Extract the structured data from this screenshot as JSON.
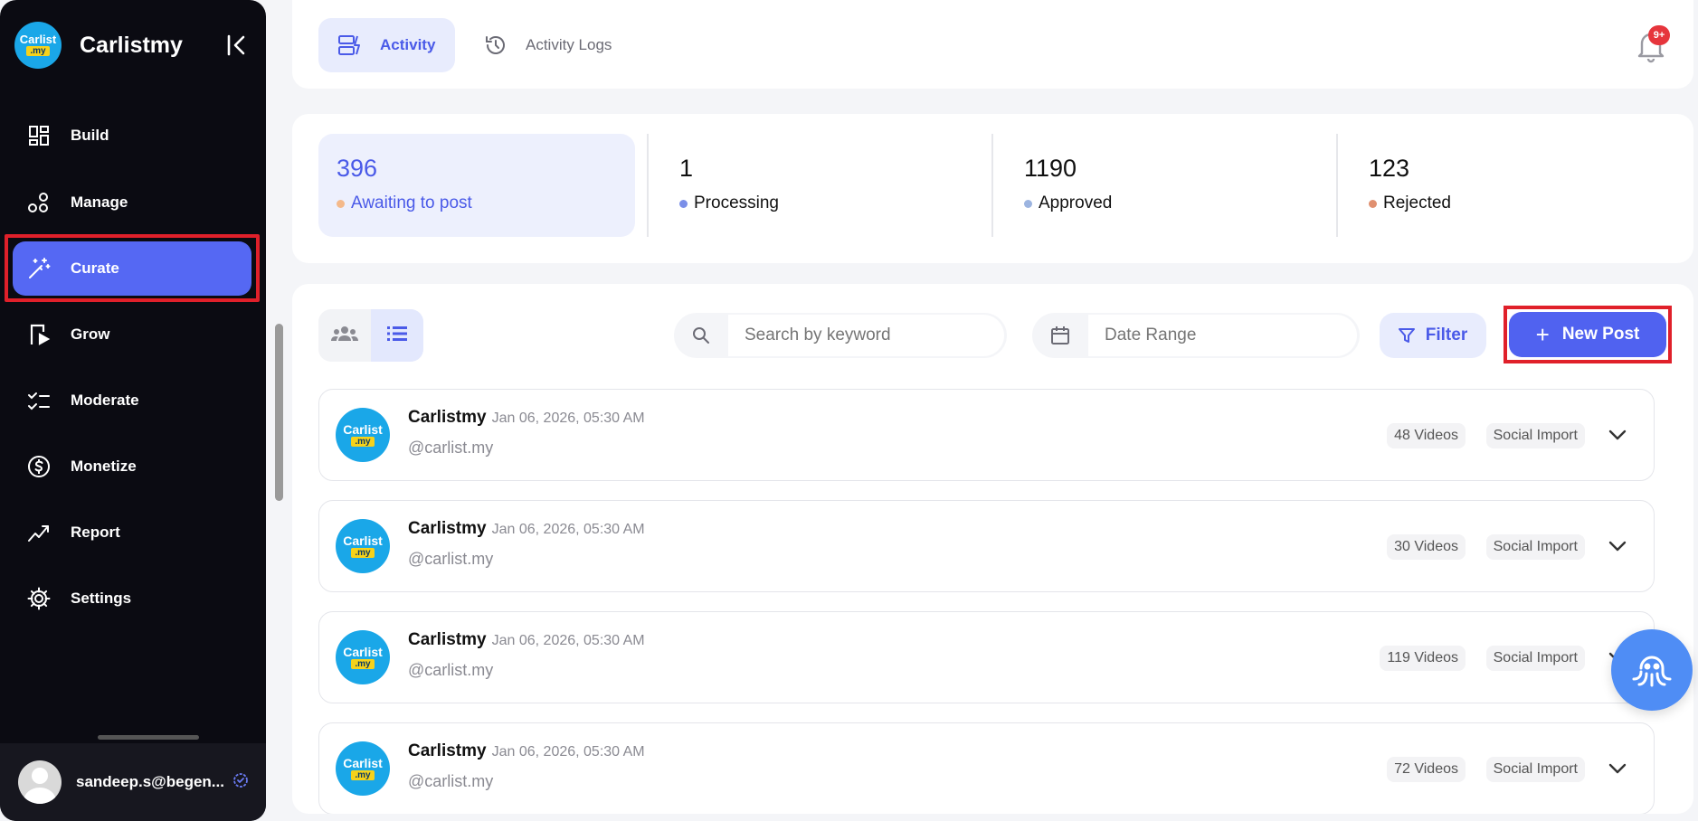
{
  "app": {
    "brand_name": "Carlistmy",
    "logo_text_top": "Carlist",
    "logo_text_bottom": ".my"
  },
  "sidebar": {
    "items": [
      {
        "label": "Build",
        "icon": "dashboard-grid-icon"
      },
      {
        "label": "Manage",
        "icon": "nodes-icon"
      },
      {
        "label": "Curate",
        "icon": "magic-wand-icon",
        "active": true
      },
      {
        "label": "Grow",
        "icon": "phone-play-icon"
      },
      {
        "label": "Moderate",
        "icon": "checklist-icon"
      },
      {
        "label": "Monetize",
        "icon": "dollar-circle-icon"
      },
      {
        "label": "Report",
        "icon": "trend-line-icon"
      },
      {
        "label": "Settings",
        "icon": "gear-icon"
      }
    ],
    "user_email": "sandeep.s@begen..."
  },
  "header": {
    "tabs": [
      {
        "label": "Activity",
        "active": true
      },
      {
        "label": "Activity Logs",
        "active": false
      }
    ],
    "notification_badge": "9+"
  },
  "stats": [
    {
      "value": "396",
      "label": "Awaiting to post",
      "dot_color": "#f4b98a"
    },
    {
      "value": "1",
      "label": "Processing",
      "dot_color": "#7b8fe8"
    },
    {
      "value": "1190",
      "label": "Approved",
      "dot_color": "#9cb4e0"
    },
    {
      "value": "123",
      "label": "Rejected",
      "dot_color": "#e09070"
    }
  ],
  "toolbar": {
    "search_placeholder": "Search by keyword",
    "date_placeholder": "Date Range",
    "filter_label": "Filter",
    "new_post_label": "New Post"
  },
  "posts": [
    {
      "name": "Carlistmy",
      "date": "Jan 06, 2026, 05:30 AM",
      "handle": "@carlist.my",
      "videos": "48 Videos",
      "source": "Social Import"
    },
    {
      "name": "Carlistmy",
      "date": "Jan 06, 2026, 05:30 AM",
      "handle": "@carlist.my",
      "videos": "30 Videos",
      "source": "Social Import"
    },
    {
      "name": "Carlistmy",
      "date": "Jan 06, 2026, 05:30 AM",
      "handle": "@carlist.my",
      "videos": "119 Videos",
      "source": "Social Import"
    },
    {
      "name": "Carlistmy",
      "date": "Jan 06, 2026, 05:30 AM",
      "handle": "@carlist.my",
      "videos": "72 Videos",
      "source": "Social Import"
    }
  ],
  "colors": {
    "accent": "#5062f0",
    "sidebar_bg": "#0b0b12",
    "highlight_frame": "#e0202a"
  }
}
